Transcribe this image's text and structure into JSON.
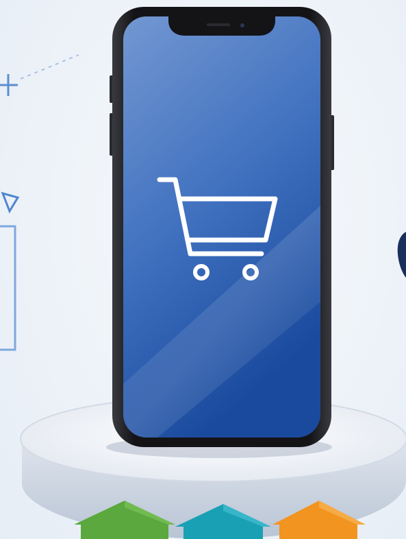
{
  "scene": {
    "subject": "smartphone-on-pedestal",
    "screen_icon": "shopping-cart-icon",
    "colors": {
      "background": "#edf2f8",
      "screen_top": "#6d93cf",
      "screen_bottom": "#1d4d9f",
      "phone_frame": "#1b1b1f",
      "pedestal_top": "#eef1f6",
      "pedestal_side": "#c9d1de",
      "deco_line": "#8fb2dc",
      "arrow_green": "#5aa83e",
      "arrow_teal": "#1aa0b5",
      "arrow_orange": "#f29420",
      "icon_stroke": "#ffffff"
    },
    "decorations": [
      "plus-sign-icon",
      "triangle-outline-icon",
      "rectangle-outline-icon",
      "dashed-line",
      "partial-dark-object"
    ],
    "arrows": [
      "green-up-arrow-icon",
      "teal-up-arrow-icon",
      "orange-up-arrow-icon"
    ]
  }
}
